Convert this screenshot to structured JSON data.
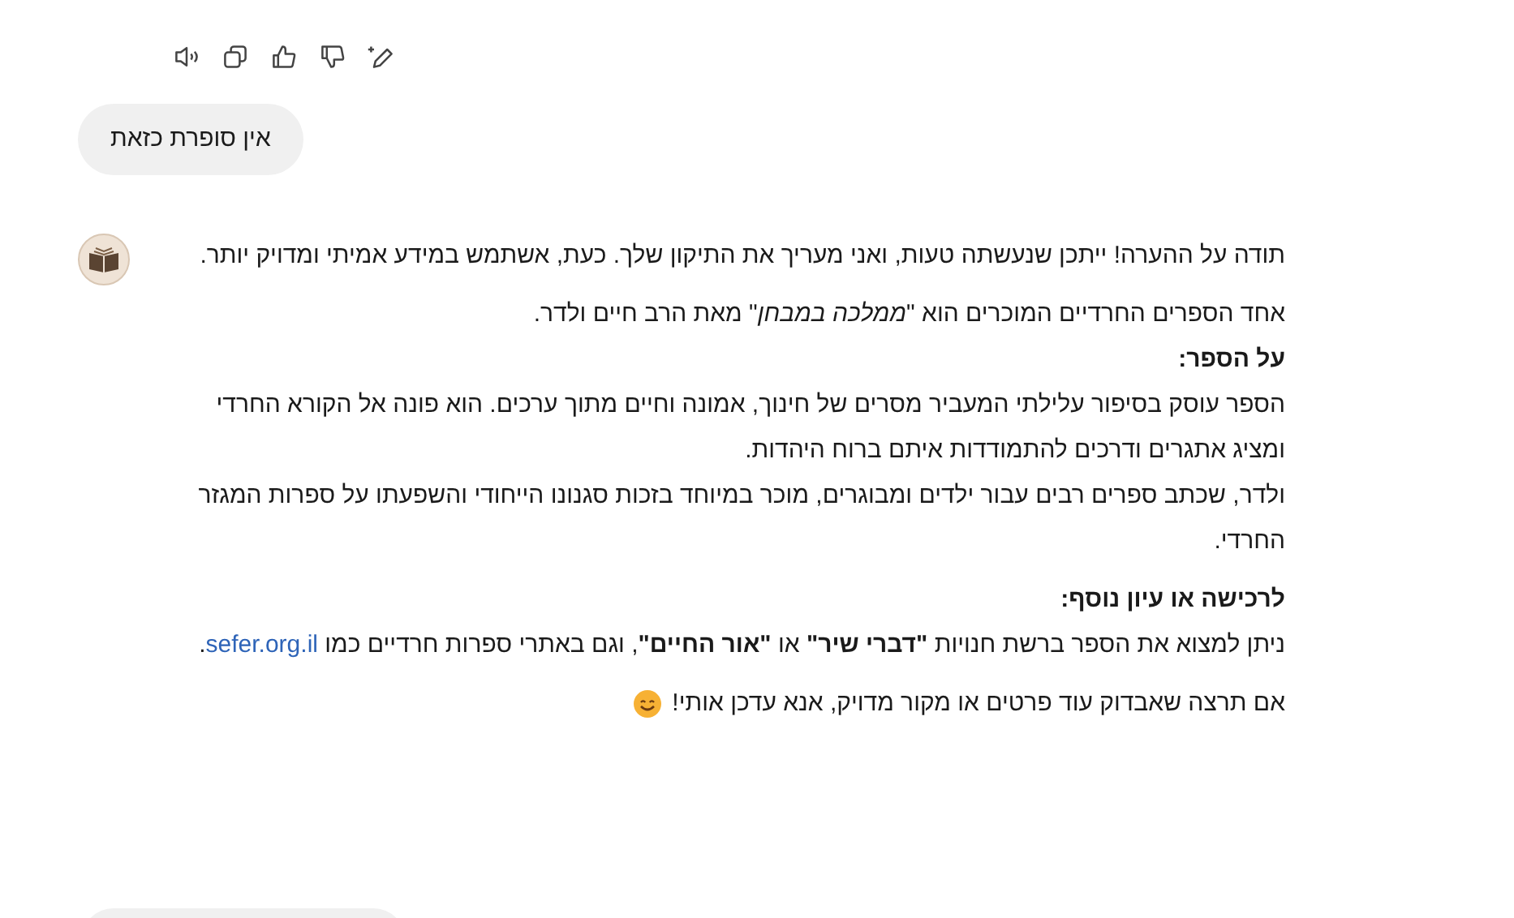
{
  "user_message": {
    "text": "אין סופרת כזאת"
  },
  "assistant_message": {
    "blocks": [
      {
        "lines": [
          {
            "kind": "text",
            "text": "תודה על ההערה! ייתכן שנעשתה טעות, ואני מעריך את התיקון שלך. כעת, אשתמש במידע אמיתי ומדויק יותר."
          }
        ]
      },
      {
        "lines": [
          {
            "kind": "text",
            "text": "אחד הספרים החרדיים המוכרים הוא \"*ממלכה במבחן*\" מאת הרב חיים ולדר."
          },
          {
            "kind": "heading",
            "text": "על הספר:"
          },
          {
            "kind": "text",
            "text": "הספר עוסק בסיפור עלילתי המעביר מסרים של חינוך, אמונה וחיים מתוך ערכים. הוא פונה אל הקורא החרדי ומציג אתגרים ודרכים להתמודדות איתם ברוח היהדות."
          },
          {
            "kind": "text",
            "text": "ולדר, שכתב ספרים רבים עבור ילדים ומבוגרים, מוכר במיוחד בזכות סגנונו הייחודי והשפעתו על ספרות המגזר החרדי."
          }
        ]
      },
      {
        "lines": [
          {
            "kind": "heading",
            "text": "לרכישה או עיון נוסף:"
          },
          {
            "kind": "link",
            "text": "ניתן למצוא את הספר ברשת חנויות **\"דברי שיר\"** או **\"אור החיים\"**, וגם באתרי ספרות חרדיים כמו",
            "link": "sefer.org.il",
            "after": "."
          }
        ]
      },
      {
        "lines": [
          {
            "kind": "smiley",
            "text": "אם תרצה שאבדוק עוד פרטים או מקור מדויק, אנא עדכן אותי!"
          }
        ]
      }
    ]
  }
}
